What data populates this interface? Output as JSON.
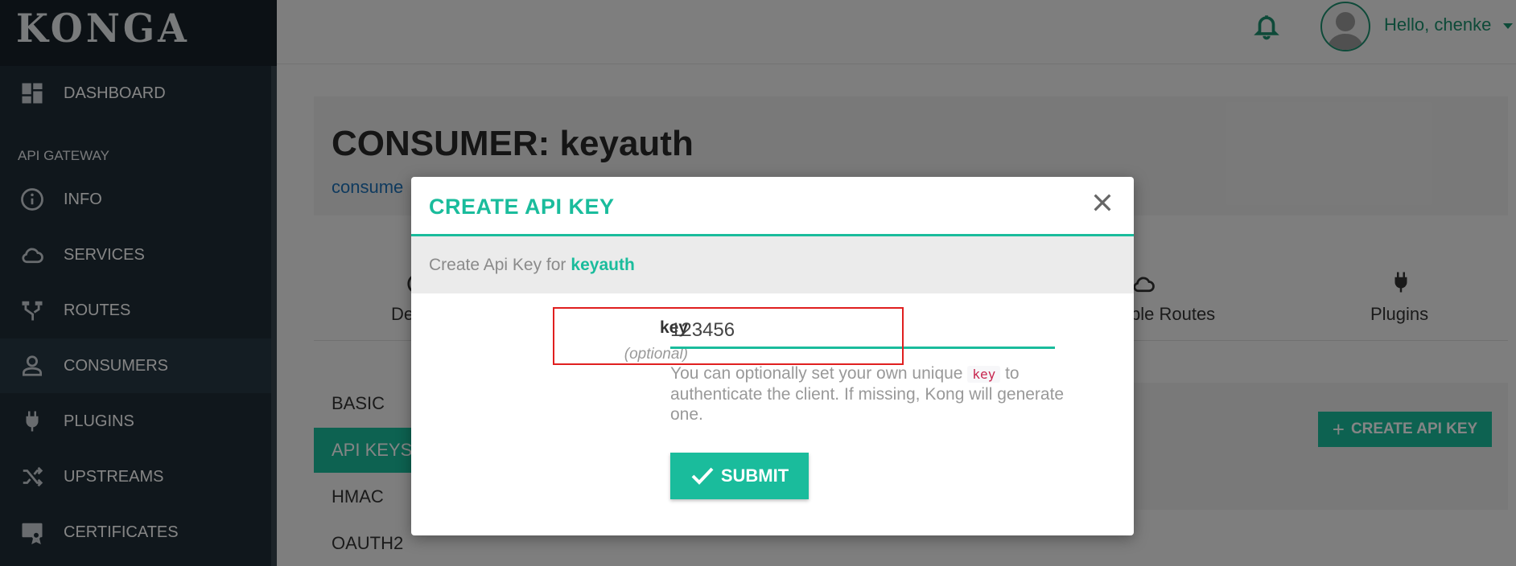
{
  "app": {
    "brand": "KONGA"
  },
  "sidebar": {
    "section_label": "API GATEWAY",
    "items": [
      {
        "label": "DASHBOARD",
        "icon": "dashboard-icon"
      },
      {
        "label": "INFO",
        "icon": "info-icon"
      },
      {
        "label": "SERVICES",
        "icon": "cloud-icon"
      },
      {
        "label": "ROUTES",
        "icon": "routes-icon"
      },
      {
        "label": "CONSUMERS",
        "icon": "user-icon",
        "active": true
      },
      {
        "label": "PLUGINS",
        "icon": "plug-icon"
      },
      {
        "label": "UPSTREAMS",
        "icon": "shuffle-icon"
      },
      {
        "label": "CERTIFICATES",
        "icon": "certificate-icon"
      }
    ]
  },
  "header": {
    "greeting": "Hello, chenke"
  },
  "page": {
    "title": "CONSUMER: keyauth",
    "breadcrumb": "consume",
    "tabs": [
      {
        "label": "De",
        "icon": "details-icon"
      },
      {
        "label": "ble Routes",
        "icon": "cloud-icon"
      },
      {
        "label": "Plugins",
        "icon": "plug-icon"
      }
    ],
    "side_menu": [
      "BASIC",
      "API KEYS",
      "HMAC",
      "OAUTH2"
    ],
    "create_button": "CREATE API KEY"
  },
  "modal": {
    "title": "CREATE API KEY",
    "subheader_prefix": "Create Api Key for",
    "consumer_name": "keyauth",
    "field_label": "key",
    "field_optional": "(optional)",
    "field_value": "123456",
    "help_before": "You can optionally set your own unique",
    "help_code": "key",
    "help_after": "to authenticate the client. If missing, Kong will generate one.",
    "submit_label": "SUBMIT"
  },
  "colors": {
    "accent": "#1abc9c",
    "sidebar": "#1f2d37",
    "highlight": "#e01f1f"
  }
}
